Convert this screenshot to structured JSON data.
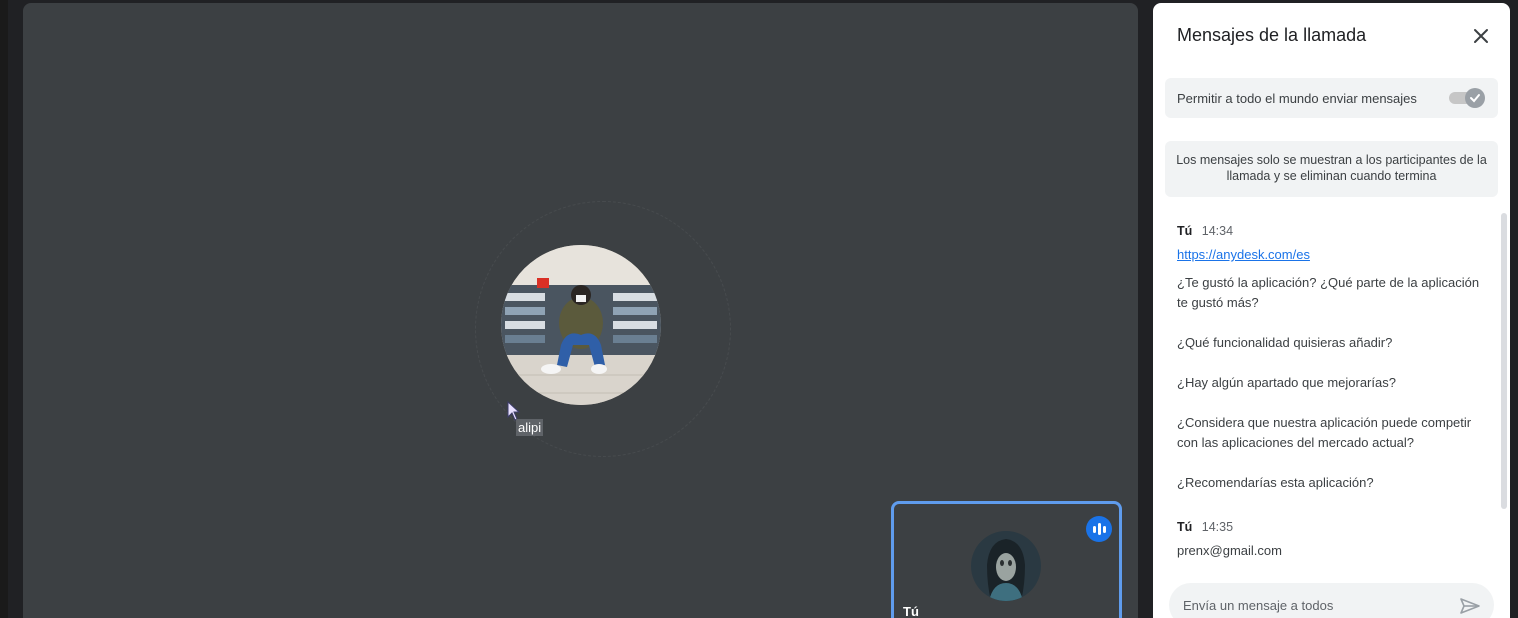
{
  "stage": {
    "participant_name": "alipi",
    "self_label": "Tú",
    "icons": {
      "main_avatar": "participant-avatar",
      "self_avatar": "self-avatar",
      "speaking": "speaking-indicator-icon",
      "cursor": "mouse-cursor-icon"
    }
  },
  "panel": {
    "title": "Mensajes de la llamada",
    "close_icon": "close-icon",
    "toggle_label": "Permitir a todo el mundo enviar mensajes",
    "toggle_on": true,
    "info": "Los mensajes solo se muestran a los participantes de la llamada y se eliminan cuando termina",
    "messages": [
      {
        "sender": "Tú",
        "time": "14:34",
        "link": "https://anydesk.com/es",
        "lines": [
          "¿Te gustó la aplicación? ¿Qué parte de la aplicación te gustó más?",
          "¿Qué funcionalidad quisieras añadir?",
          "¿Hay algún apartado que mejorarías?",
          "¿Considera que nuestra aplicación puede competir con las aplicaciones del mercado actual?",
          "¿Recomendarías esta aplicación?"
        ]
      },
      {
        "sender": "Tú",
        "time": "14:35",
        "lines": [
          "prenx@gmail.com"
        ]
      }
    ],
    "input_placeholder": "Envía un mensaje a todos",
    "send_icon": "send-icon"
  },
  "colors": {
    "stage_bg": "#3c4043",
    "accent": "#1a73e8",
    "tile_border": "#5f9ced",
    "panel_bg": "#ffffff"
  }
}
